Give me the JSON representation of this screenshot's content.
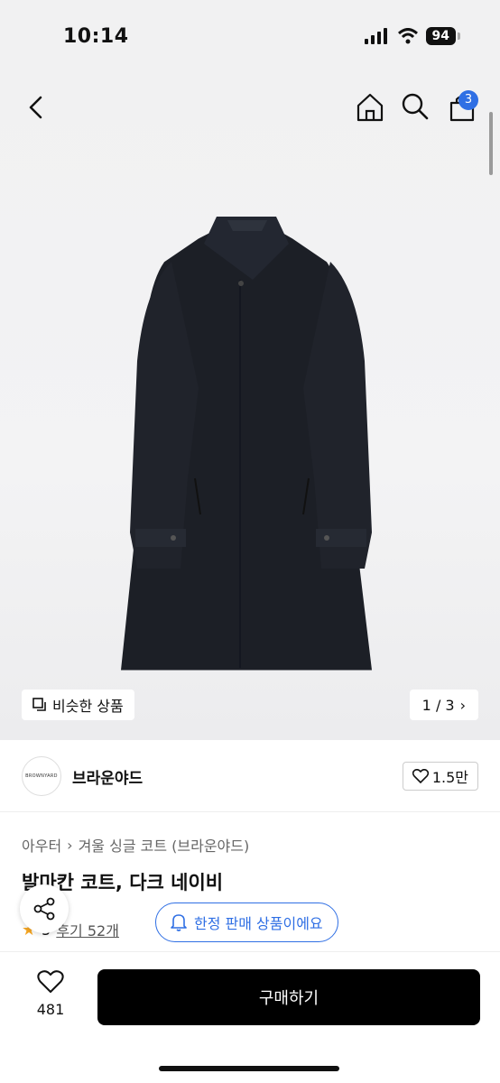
{
  "status_bar": {
    "time": "10:14",
    "battery": "94"
  },
  "nav": {
    "cart_count": "3"
  },
  "hero": {
    "similar_label": "비슷한 상품",
    "page_indicator": "1 / 3"
  },
  "brand": {
    "logo_text": "BROWNYARD",
    "name": "브라운야드",
    "likes": "1.5만"
  },
  "breadcrumb": {
    "category": "아우터",
    "subcategory": "겨울 싱글 코트 (브라운야드)"
  },
  "product": {
    "title": "발마칸 코트, 다크 네이비",
    "rating": "5",
    "reviews": "후기 52개",
    "limited_label": "한정 판매 상품이에요"
  },
  "bottom": {
    "like_count": "481",
    "buy_label": "구매하기"
  },
  "colors": {
    "accent": "#2f6fe4",
    "coat": "#1c1f26",
    "buy_button": "#000000"
  }
}
